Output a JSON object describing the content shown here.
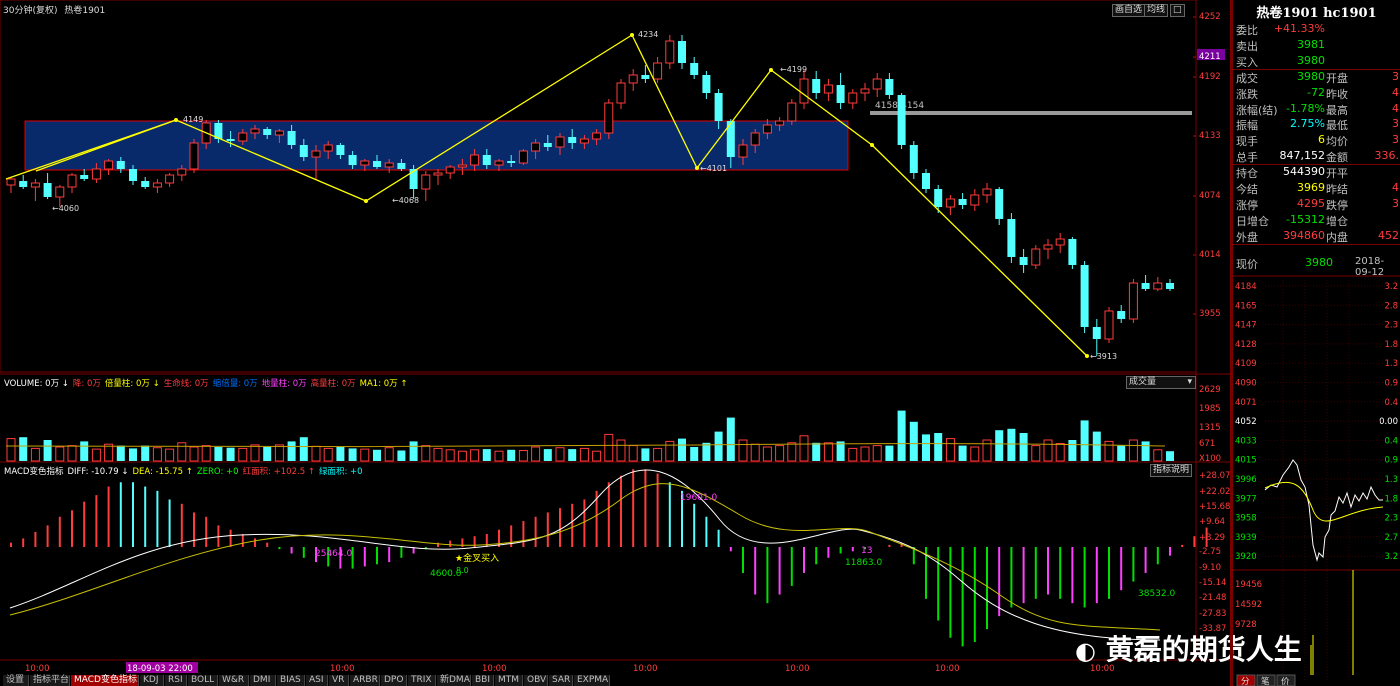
{
  "title_bar": {
    "period": "30分钟(复权)",
    "symbol": "热卷1901"
  },
  "toolbar_buttons": [
    "画自选",
    "均线",
    "□"
  ],
  "price_axis": [
    "4252",
    "4211",
    "4192",
    "4133",
    "4074",
    "4014",
    "3955"
  ],
  "annotations": {
    "p4149": "4149",
    "p4060": "4060",
    "p4068": "4068",
    "p4234": "4234",
    "p4101": "4101",
    "p4199": "4199",
    "range": "4158-4154",
    "p3913": "3913"
  },
  "volume_header": {
    "items": [
      {
        "text": "VOLUME: 0万 ↓",
        "color": "#ffffff"
      },
      {
        "text": "降: 0万",
        "color": "#ff3c3c"
      },
      {
        "text": "倍量柱: 0万 ↓",
        "color": "#ffff00"
      },
      {
        "text": "生命线: 0万",
        "color": "#ff3c3c"
      },
      {
        "text": "缩倍量: 0万",
        "color": "#0070ff"
      },
      {
        "text": "地量柱: 0万",
        "color": "#ff40ff"
      },
      {
        "text": "高量柱: 0万",
        "color": "#ff3c3c"
      },
      {
        "text": "MA1: 0万 ↑",
        "color": "#ffff00"
      }
    ],
    "dropdown": "成交量"
  },
  "volume_axis": [
    "2629",
    "1985",
    "1315",
    "671",
    "X100"
  ],
  "macd_header": {
    "items": [
      {
        "text": "MACD变色指标",
        "color": "#ffffff"
      },
      {
        "text": "DIFF: -10.79 ↓",
        "color": "#ffffff"
      },
      {
        "text": "DEA: -15.75 ↑",
        "color": "#ffff00"
      },
      {
        "text": "ZERO: +0",
        "color": "#00ff00"
      },
      {
        "text": "红面积: +102.5 ↑",
        "color": "#ff3c3c"
      },
      {
        "text": "绿面积: +0",
        "color": "#00ffff"
      }
    ],
    "button": "指标说明"
  },
  "macd_axis": [
    "+28.07",
    "+22.02",
    "+15.68",
    "+9.64",
    "+3.29",
    "-2.75",
    "-9.10",
    "-15.14",
    "-21.48",
    "-27.83",
    "-33.87"
  ],
  "macd_labels": {
    "a1": "25464.0",
    "a2": "19601.0",
    "a3": "4600.0",
    "a4": "8.0",
    "a5": "金叉买入",
    "a6": "11863.0",
    "a7": "38532.0",
    "a8": "13"
  },
  "time_axis": [
    "10:00",
    "18-09-03 22:00",
    "10:00",
    "10:00",
    "10:00",
    "10:00",
    "10:00",
    "10:00"
  ],
  "bottom_tabs": [
    "设置",
    "指标平台",
    "MACD变色指标",
    "KDJ",
    "RSI",
    "BOLL",
    "W&R",
    "DMI",
    "BIAS",
    "ASI",
    "VR",
    "ARBR",
    "DPO",
    "TRIX",
    "新DMA",
    "BBI",
    "MTM",
    "OBV",
    "SAR",
    "EXPMA"
  ],
  "right_panel": {
    "title": "热卷1901 hc1901",
    "rows": [
      {
        "l": "委比",
        "v": "+41.33%",
        "vc": "#ff3c3c",
        "l2": "",
        "v2": ""
      },
      {
        "l": "卖出",
        "v": "3981",
        "vc": "#00e000",
        "l2": "",
        "v2": ""
      },
      {
        "l": "买入",
        "v": "3980",
        "vc": "#00e000",
        "l2": "",
        "v2": ""
      },
      {
        "l": "成交",
        "v": "3980",
        "vc": "#00e000",
        "l2": "开盘",
        "v2": "3"
      },
      {
        "l": "涨跌",
        "v": "-72",
        "vc": "#00e000",
        "l2": "昨收",
        "v2": "4"
      },
      {
        "l": "涨幅(结)",
        "v": "-1.78%",
        "vc": "#00e000",
        "l2": "最高",
        "v2": "4"
      },
      {
        "l": "振幅",
        "v": "2.75%",
        "vc": "#00ffff",
        "l2": "最低",
        "v2": "3"
      },
      {
        "l": "现手",
        "v": "6",
        "vc": "#ffff00",
        "l2": "均价",
        "v2": "3"
      },
      {
        "l": "总手",
        "v": "847,152",
        "vc": "#ffffff",
        "l2": "金额",
        "v2": "336."
      },
      {
        "l": "持仓",
        "v": "544390",
        "vc": "#ffffff",
        "l2": "开平",
        "v2": ""
      },
      {
        "l": "今结",
        "v": "3969",
        "vc": "#ffff00",
        "l2": "昨结",
        "v2": "4"
      },
      {
        "l": "涨停",
        "v": "4295",
        "vc": "#ff3c3c",
        "l2": "跌停",
        "v2": "3"
      },
      {
        "l": "日增仓",
        "v": "-15312",
        "vc": "#00e000",
        "l2": "增仓",
        "v2": ""
      },
      {
        "l": "外盘",
        "v": "394860",
        "vc": "#ff3c3c",
        "l2": "内盘",
        "v2": "452"
      }
    ],
    "price_now_label": "现价",
    "price_now": "3980",
    "date": "2018-09-12",
    "mini_axis_left": [
      "4184",
      "4165",
      "4147",
      "4128",
      "4109",
      "4090",
      "4071",
      "4052",
      "4033",
      "4015",
      "3996",
      "3977",
      "3958",
      "3939",
      "3920"
    ],
    "mini_axis_right": [
      "3.2",
      "2.8",
      "2.3",
      "1.8",
      "1.3",
      "0.9",
      "0.4",
      "0.00",
      "0.4",
      "0.9",
      "1.3",
      "1.8",
      "2.3",
      "2.7",
      "3.2"
    ],
    "vol_axis": [
      "19456",
      "14592",
      "9728"
    ],
    "bottom_tabs": [
      "分",
      "笔",
      "价"
    ]
  },
  "watermark": "黄磊的期货人生",
  "colors": {
    "up": "#ff3c3c",
    "down": "#54ffff",
    "box_fill": "#082a6a",
    "box_stroke": "#e00000",
    "trend": "#ffff00",
    "grid": "#7a0000"
  }
}
